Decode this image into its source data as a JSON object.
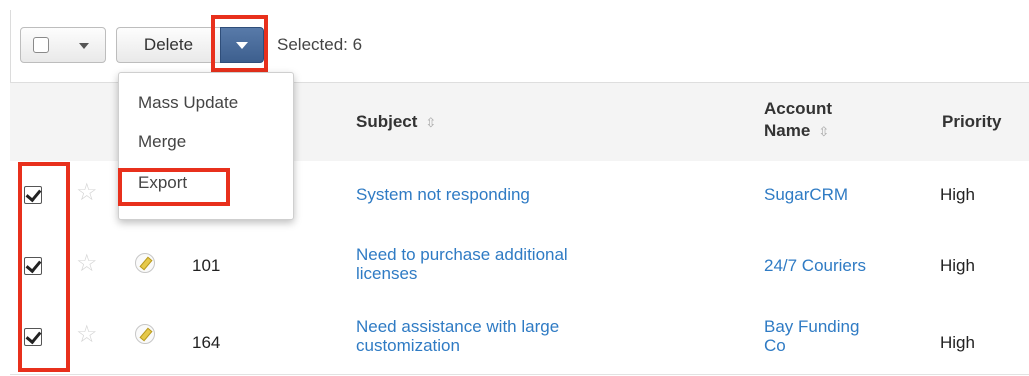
{
  "toolbar": {
    "delete_label": "Delete",
    "selected_label": "Selected: 6"
  },
  "menu": {
    "items": [
      {
        "label": "Mass Update"
      },
      {
        "label": "Merge"
      },
      {
        "label": "Export"
      }
    ]
  },
  "table": {
    "headers": {
      "subject": "Subject",
      "account_line1": "Account",
      "account_line2": "Name",
      "priority": "Priority",
      "sort_icon": "⇳"
    },
    "rows": [
      {
        "number": "",
        "subject_line1": "System not responding",
        "subject_line2": "",
        "account_line1": "SugarCRM",
        "account_line2": "",
        "priority": "High"
      },
      {
        "number": "101",
        "subject_line1": "Need to purchase additional",
        "subject_line2": "licenses",
        "account_line1": "24/7 Couriers",
        "account_line2": "",
        "priority": "High"
      },
      {
        "number": "164",
        "subject_line1": "Need assistance with large",
        "subject_line2": "customization",
        "account_line1": "Bay Funding",
        "account_line2": "Co",
        "priority": "High"
      }
    ]
  },
  "colors": {
    "highlight": "#e8301c",
    "link": "#2f7bc4",
    "split_button": "#4a6b9b"
  }
}
